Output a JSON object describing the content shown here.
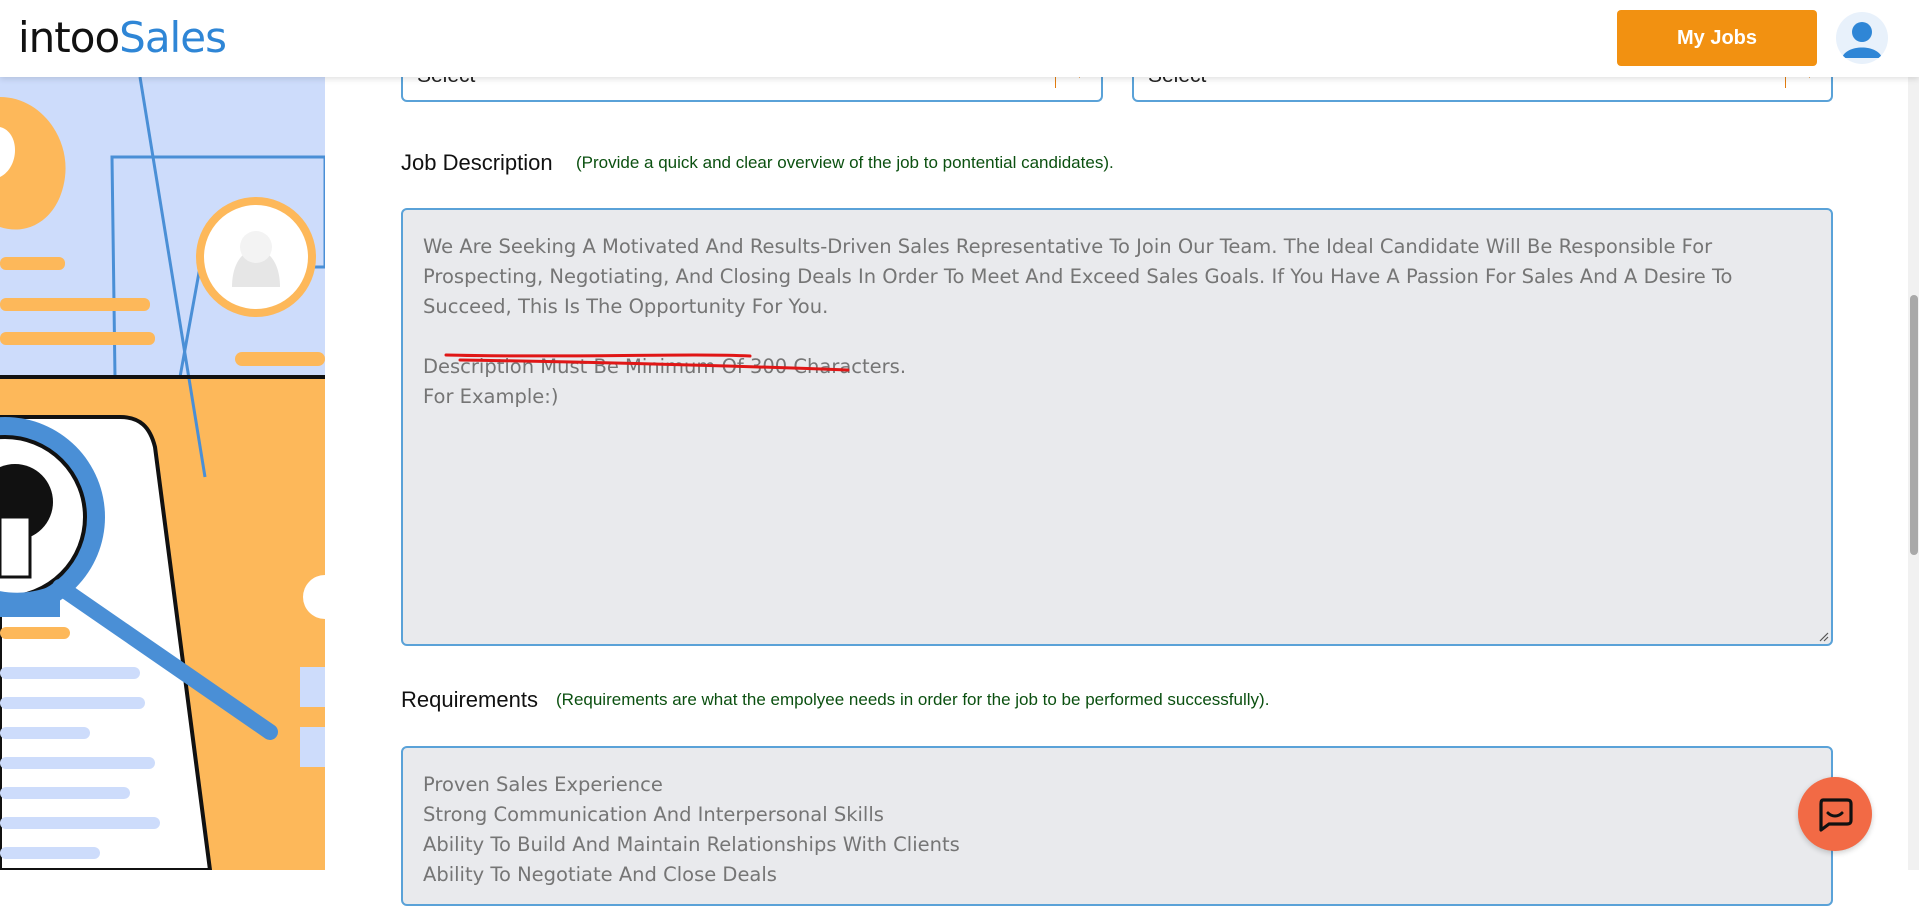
{
  "header": {
    "logo_part1": "intoo",
    "logo_part2": "Sales",
    "my_jobs_label": "My Jobs",
    "avatar_icon": "user-avatar-icon"
  },
  "form": {
    "select_left_value": "Select",
    "select_right_value": "Select",
    "job_description": {
      "title": "Job Description",
      "hint": "(Provide a quick and clear overview of the job to pontential candidates).",
      "placeholder_line1": "We Are Seeking A Motivated And Results-Driven Sales Representative To Join Our Team. The Ideal Candidate Will Be Responsible For Prospecting, Negotiating, And Closing Deals In Order To Meet And Exceed Sales Goals. If You Have A Passion For Sales And A Desire To Succeed, This Is The Opportunity For You.",
      "placeholder_line2": "Description Must Be Minimum Of 300 Characters.",
      "placeholder_line3": "For Example:)"
    },
    "requirements": {
      "title": "Requirements",
      "hint": "(Requirements are what the empolyee needs in order for the job to be performed successfully).",
      "items": [
        "Proven Sales Experience",
        "Strong Communication And Interpersonal Skills",
        "Ability To Build And Maintain Relationships With Clients",
        "Ability To Negotiate And Close Deals"
      ]
    }
  },
  "colors": {
    "accent_orange": "#f29111",
    "field_border": "#5aa2d8",
    "hint_green": "#0b5010",
    "annotation_red": "#e01616",
    "chat_button": "#f26a45"
  },
  "icons": {
    "chat": "chat-bubble-icon",
    "dropdown": "chevron-down-icon",
    "resize": "resize-handle-icon"
  }
}
